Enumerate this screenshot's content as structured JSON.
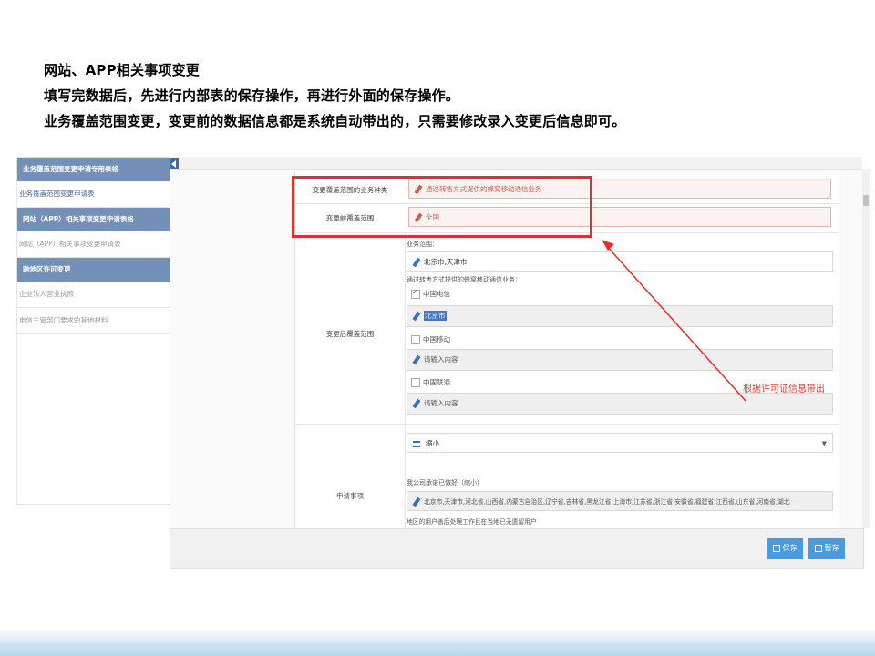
{
  "headings": {
    "line1": "网站、APP相关事项变更",
    "line2": "填写完数据后，先进行内部表的保存操作，再进行外面的保存操作。",
    "line3": "业务覆盖范围变更，变更前的数据信息都是系统自动带出的，只需要修改录入变更后信息即可。"
  },
  "sidebar": {
    "head1": "业务覆盖范围变更申请专用表格",
    "item1": "业务覆盖范围变更申请表",
    "head2": "网站（APP）相关事项变更申请表格",
    "item2": "网站（APP）相关事项变更申请表",
    "head3": "跨地区许可变更",
    "item3": "企业法人营业执照",
    "item4": "电信主管部门要求的其他材料"
  },
  "form": {
    "row1_label": "变更覆盖范围的业务种类",
    "row1_value": "通过转售方式提供的蜂窝移动通信业务",
    "row2_label": "变更前覆盖范围",
    "row2_value": "全国",
    "row3_label": "变更后覆盖范围",
    "biz_scope_label": "业务范围：",
    "biz_scope_value": "北京市,天津市",
    "service_label": "通过转售方式提供的蜂窝移动通信业务：",
    "opt1": "中国电信",
    "opt1_value": "北京市",
    "opt2": "中国移动",
    "opt2_placeholder": "请输入内容",
    "opt3": "中国联通",
    "opt3_placeholder": "请输入内容",
    "row4_label": "申请事项",
    "dropdown_value": "缩小",
    "commit_label": "我公司承诺已做好（缩小）",
    "commit_value": "北京市,天津市,河北省,山西省,内蒙古自治区,辽宁省,吉林省,黑龙江省,上海市,江苏省,浙江省,安徽省,福建省,江西省,山东省,河南省,湖北",
    "commit_tail": "地区的用户善后处理工作且在当地已无遗留用户"
  },
  "buttons": {
    "save": "保存",
    "temp_save": "暂存"
  },
  "annotation": {
    "text": "根据许可证信息带出"
  },
  "colors": {
    "accent": "#4a9ae0",
    "sidebar_head": "#7390b8",
    "callout": "#e62d2d"
  }
}
